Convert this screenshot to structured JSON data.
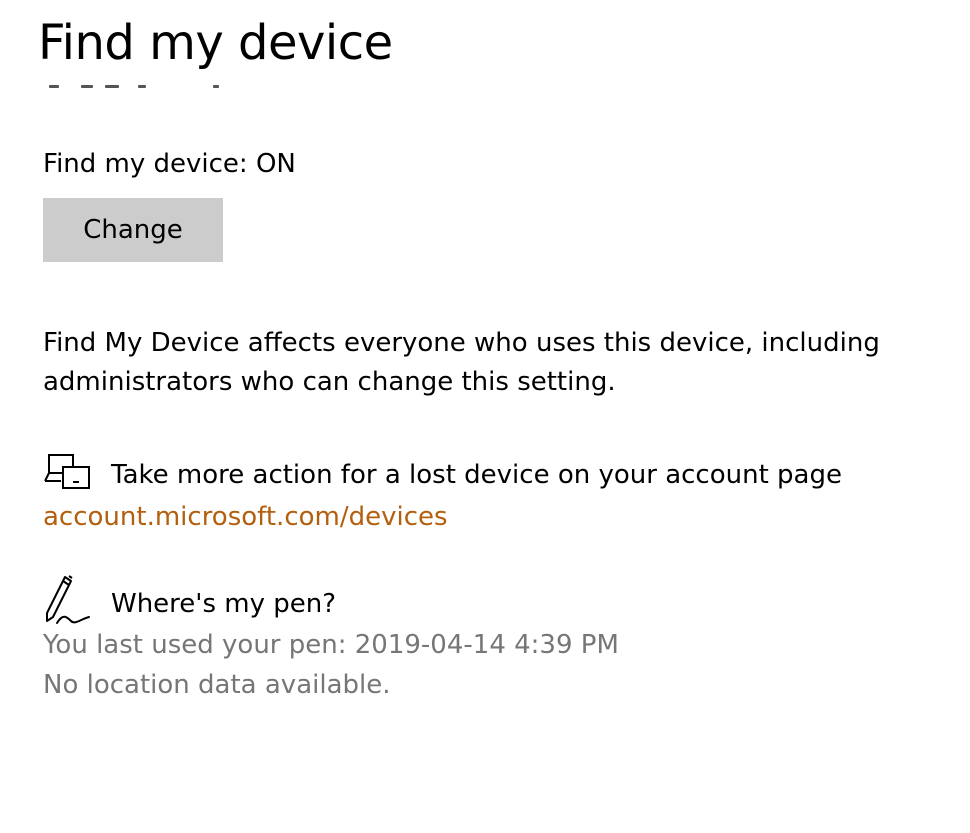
{
  "page": {
    "title": "Find my device"
  },
  "find_my_device": {
    "status_text": "Find my device: ON",
    "change_button_label": "Change",
    "info_text": "Find My Device affects everyone who uses this device, including administrators who can change this setting."
  },
  "lost_device": {
    "icon": "devices-icon",
    "label": "Take more action for a lost device on your account page",
    "link_text": "account.microsoft.com/devices",
    "link_color": "#b35f0e"
  },
  "pen": {
    "icon": "pen-icon",
    "label": "Where's my pen?",
    "last_used": "You last used your pen: 2019-04-14 4:39 PM",
    "location": "No location data available.",
    "secondary_color": "#767676"
  }
}
